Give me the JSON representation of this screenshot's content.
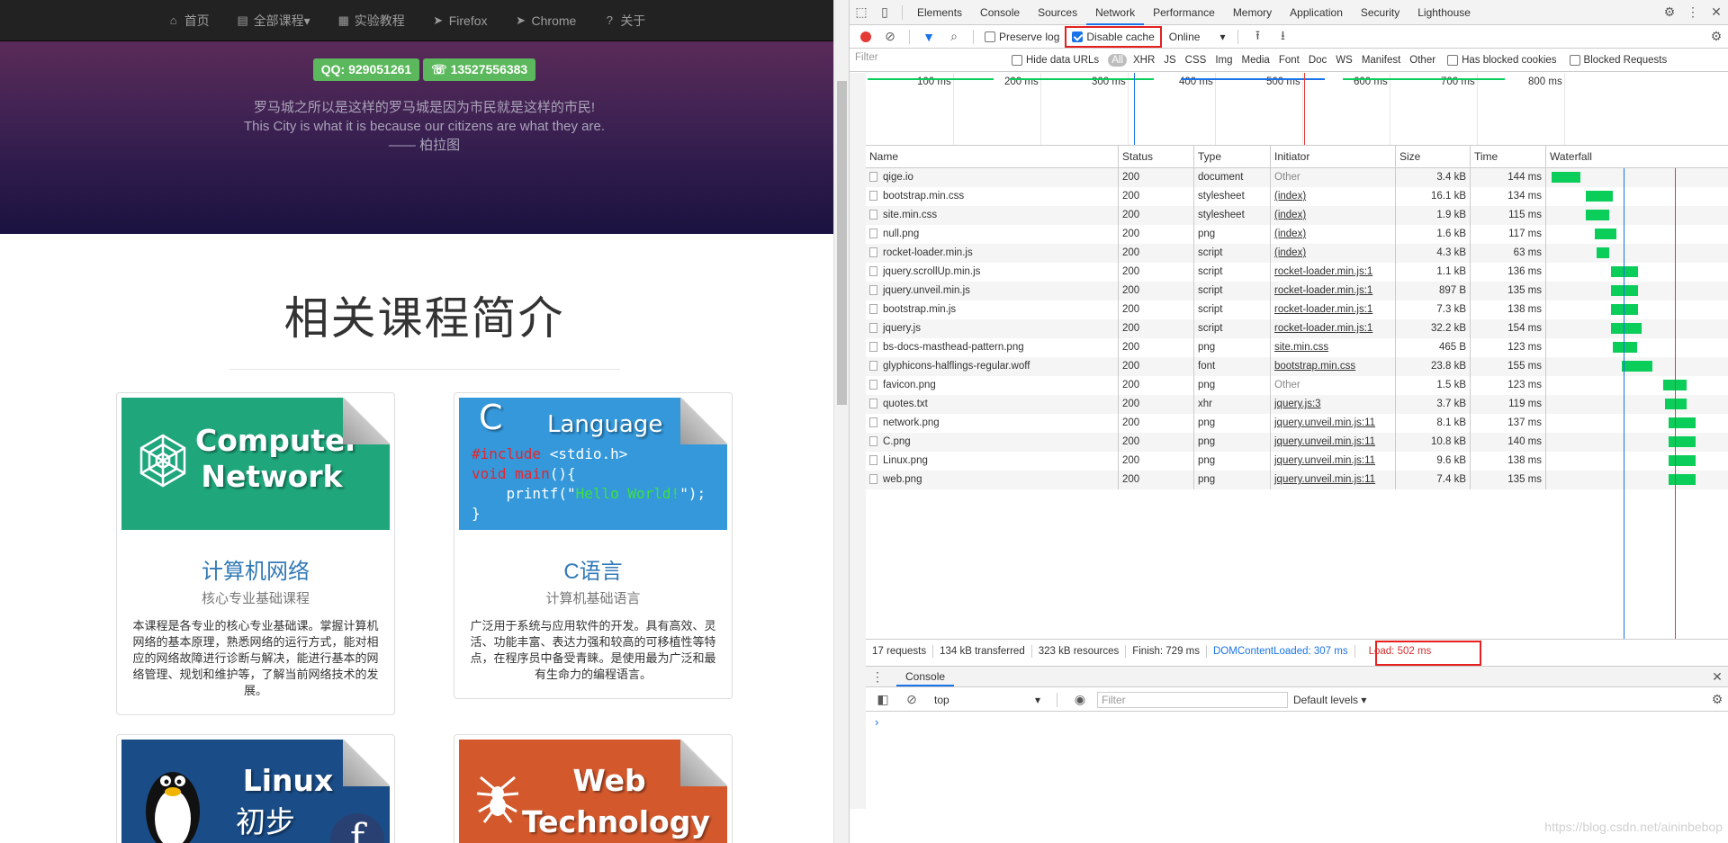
{
  "site": {
    "nav": [
      {
        "icon": "home-icon",
        "glyph": "⌂",
        "label": "首页"
      },
      {
        "icon": "book-icon",
        "glyph": "▤",
        "label": "全部课程▾"
      },
      {
        "icon": "grid-icon",
        "glyph": "▦",
        "label": "实验教程"
      },
      {
        "icon": "send-icon",
        "glyph": "➤",
        "label": "Firefox"
      },
      {
        "icon": "send-icon",
        "glyph": "➤",
        "label": "Chrome"
      },
      {
        "icon": "question-icon",
        "glyph": "?",
        "label": "关于"
      }
    ],
    "badges": {
      "qq": "QQ: 929051261",
      "phone": "☏ 13527556383"
    },
    "quote": {
      "zh": "罗马城之所以是这样的罗马城是因为市民就是这样的市民!",
      "en": "This City is what it is because our citizens are what they are.",
      "author": "—— 柏拉图"
    },
    "section_title": "相关课程简介",
    "cards": [
      {
        "image_text": [
          "Computer",
          "Network"
        ],
        "title": "计算机网络",
        "subtitle": "核心专业基础课程",
        "desc": "本课程是各专业的核心专业基础课。掌握计算机网络的基本原理，熟悉网络的运行方式，能对相应的网络故障进行诊断与解决，能进行基本的网络管理、规划和维护等，了解当前网络技术的发展。"
      },
      {
        "image_text": [
          "C",
          "Language"
        ],
        "code": [
          "#include <stdio.h>",
          "void main(){",
          "    printf(\"Hello World!\");",
          "}"
        ],
        "title": "C语言",
        "subtitle": "计算机基础语言",
        "desc": "广泛用于系统与应用软件的开发。具有高效、灵活、功能丰富、表达力强和较高的可移植性等特点，在程序员中备受青睐。是使用最为广泛和最有生命力的编程语言。"
      },
      {
        "image_text": [
          "Linux",
          "初步"
        ]
      },
      {
        "image_text": [
          "Web",
          "Technology"
        ]
      }
    ]
  },
  "devtools": {
    "tabs": [
      "Elements",
      "Console",
      "Sources",
      "Network",
      "Performance",
      "Memory",
      "Application",
      "Security",
      "Lighthouse"
    ],
    "active_tab": "Network",
    "toolbar": {
      "preserve_log": "Preserve log",
      "disable_cache": "Disable cache",
      "throttle": "Online"
    },
    "filter": {
      "placeholder": "Filter",
      "hide_data_urls": "Hide data URLs",
      "types": [
        "All",
        "XHR",
        "JS",
        "CSS",
        "Img",
        "Media",
        "Font",
        "Doc",
        "WS",
        "Manifest",
        "Other"
      ],
      "has_blocked_cookies": "Has blocked cookies",
      "blocked_requests": "Blocked Requests"
    },
    "overview_ticks": [
      "100 ms",
      "200 ms",
      "300 ms",
      "400 ms",
      "500 ms",
      "600 ms",
      "700 ms",
      "800 ms"
    ],
    "columns": [
      "Name",
      "Status",
      "Type",
      "Initiator",
      "Size",
      "Time",
      "Waterfall"
    ],
    "requests": [
      {
        "name": "qige.io",
        "status": "200",
        "type": "document",
        "initiator": "Other",
        "size": "3.4 kB",
        "time": "144 ms",
        "wf_start": 2,
        "wf_len": 32
      },
      {
        "name": "bootstrap.min.css",
        "status": "200",
        "type": "stylesheet",
        "initiator": "(index)",
        "size": "16.1 kB",
        "time": "134 ms",
        "wf_start": 40,
        "wf_len": 30
      },
      {
        "name": "site.min.css",
        "status": "200",
        "type": "stylesheet",
        "initiator": "(index)",
        "size": "1.9 kB",
        "time": "115 ms",
        "wf_start": 40,
        "wf_len": 26
      },
      {
        "name": "null.png",
        "status": "200",
        "type": "png",
        "initiator": "(index)",
        "size": "1.6 kB",
        "time": "117 ms",
        "wf_start": 50,
        "wf_len": 24
      },
      {
        "name": "rocket-loader.min.js",
        "status": "200",
        "type": "script",
        "initiator": "(index)",
        "size": "4.3 kB",
        "time": "63 ms",
        "wf_start": 52,
        "wf_len": 14
      },
      {
        "name": "jquery.scrollUp.min.js",
        "status": "200",
        "type": "script",
        "initiator": "rocket-loader.min.js:1",
        "size": "1.1 kB",
        "time": "136 ms",
        "wf_start": 68,
        "wf_len": 30
      },
      {
        "name": "jquery.unveil.min.js",
        "status": "200",
        "type": "script",
        "initiator": "rocket-loader.min.js:1",
        "size": "897 B",
        "time": "135 ms",
        "wf_start": 68,
        "wf_len": 30
      },
      {
        "name": "bootstrap.min.js",
        "status": "200",
        "type": "script",
        "initiator": "rocket-loader.min.js:1",
        "size": "7.3 kB",
        "time": "138 ms",
        "wf_start": 68,
        "wf_len": 30
      },
      {
        "name": "jquery.js",
        "status": "200",
        "type": "script",
        "initiator": "rocket-loader.min.js:1",
        "size": "32.2 kB",
        "time": "154 ms",
        "wf_start": 68,
        "wf_len": 34
      },
      {
        "name": "bs-docs-masthead-pattern.png",
        "status": "200",
        "type": "png",
        "initiator": "site.min.css",
        "size": "465 B",
        "time": "123 ms",
        "wf_start": 70,
        "wf_len": 27
      },
      {
        "name": "glyphicons-halflings-regular.woff",
        "status": "200",
        "type": "font",
        "initiator": "bootstrap.min.css",
        "size": "23.8 kB",
        "time": "155 ms",
        "wf_start": 80,
        "wf_len": 34
      },
      {
        "name": "favicon.png",
        "status": "200",
        "type": "png",
        "initiator": "Other",
        "size": "1.5 kB",
        "time": "123 ms",
        "wf_start": 126,
        "wf_len": 26
      },
      {
        "name": "quotes.txt",
        "status": "200",
        "type": "xhr",
        "initiator": "jquery.js:3",
        "size": "3.7 kB",
        "time": "119 ms",
        "wf_start": 128,
        "wf_len": 24
      },
      {
        "name": "network.png",
        "status": "200",
        "type": "png",
        "initiator": "jquery.unveil.min.js:11",
        "size": "8.1 kB",
        "time": "137 ms",
        "wf_start": 132,
        "wf_len": 30
      },
      {
        "name": "C.png",
        "status": "200",
        "type": "png",
        "initiator": "jquery.unveil.min.js:11",
        "size": "10.8 kB",
        "time": "140 ms",
        "wf_start": 132,
        "wf_len": 30
      },
      {
        "name": "Linux.png",
        "status": "200",
        "type": "png",
        "initiator": "jquery.unveil.min.js:11",
        "size": "9.6 kB",
        "time": "138 ms",
        "wf_start": 132,
        "wf_len": 30
      },
      {
        "name": "web.png",
        "status": "200",
        "type": "png",
        "initiator": "jquery.unveil.min.js:11",
        "size": "7.4 kB",
        "time": "135 ms",
        "wf_start": 132,
        "wf_len": 30
      }
    ],
    "status": {
      "requests": "17 requests",
      "transferred": "134 kB transferred",
      "resources": "323 kB resources",
      "finish": "Finish: 729 ms",
      "dcl": "DOMContentLoaded: 307 ms",
      "load": "Load: 502 ms"
    },
    "drawer": {
      "tab": "Console",
      "context": "top",
      "filter_placeholder": "Filter",
      "levels": "Default levels ▾",
      "prompt": "›"
    },
    "watermark": "https://blog.csdn.net/aininbebop"
  }
}
